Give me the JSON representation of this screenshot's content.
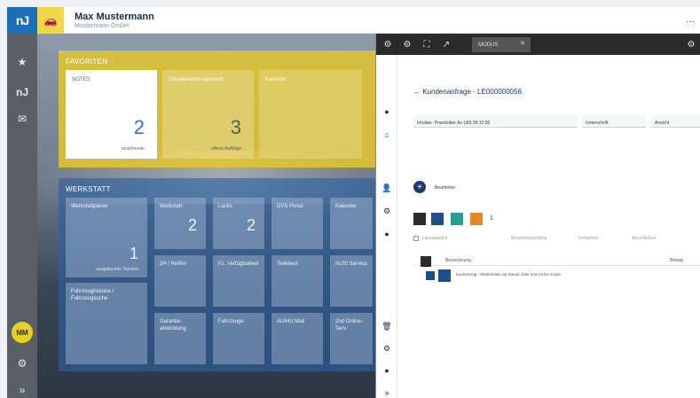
{
  "header": {
    "user_name": "Max Mustermann",
    "user_company": "Mustermann GmbH",
    "more": "...",
    "logo_text": "nJ"
  },
  "rail": {
    "avatar_initials": "MM",
    "collapse_glyph": "»"
  },
  "favoriten": {
    "title": "FAVORITEN",
    "tiles": [
      {
        "label": "NOTES",
        "value": "2",
        "sub": "anstehende"
      },
      {
        "label": "Schadensmanagement",
        "value": "3",
        "sub": "offene Aufträge"
      },
      {
        "label": "Kalender",
        "value": "",
        "sub": ""
      }
    ]
  },
  "werkstatt": {
    "title": "WERKSTATT",
    "tiles": [
      {
        "label": "Werkstattplaner",
        "value": "1",
        "sub": "ausgebuchte Termine"
      },
      {
        "label": "Fahrzeughistorie / Fahrzeugsuche",
        "value": "",
        "sub": ""
      },
      {
        "label": "Werkstatt",
        "value": "2",
        "sub": ""
      },
      {
        "label": "Lacks",
        "value": "2",
        "sub": ""
      },
      {
        "label": "DVS Portal",
        "value": "",
        "sub": ""
      },
      {
        "label": "Kalender",
        "value": "",
        "sub": ""
      },
      {
        "label": "2H / Reifen",
        "value": "",
        "sub": ""
      },
      {
        "label": "Fz. Verfügbarkeit",
        "value": "",
        "sub": ""
      },
      {
        "label": "Teilebest.",
        "value": "",
        "sub": ""
      },
      {
        "label": "AUSt Service",
        "value": "",
        "sub": ""
      },
      {
        "label": "Garantie- abwicklung",
        "value": "",
        "sub": ""
      },
      {
        "label": "Fahrzeuge",
        "value": "",
        "sub": ""
      },
      {
        "label": "AU/HU Mail",
        "value": "",
        "sub": ""
      },
      {
        "label": "2nd Online-Serv",
        "value": "",
        "sub": ""
      }
    ]
  },
  "panel": {
    "tab_label": "MODUS",
    "title": "Kundenanfrage - LE000000056",
    "field1_value": "Inhaber: Prandsitter Ae (d0) 09:10:00",
    "field2_value": "Unterschrift",
    "field3_value": "Ansicht",
    "field4_value": "",
    "row_add_label": "Bearbeiter",
    "toolbar_labels": [
      "Lausgewählt",
      "Bearbeitungsfähig",
      "Freigeben",
      "Abschließen"
    ],
    "table_header": [
      "Bezeichnung",
      "Betrag"
    ],
    "table_rows": [
      {
        "text": "Kaufvertrag - Weiterleiten an Steuer, bitte erst vorher Kopie"
      }
    ],
    "counter": "1"
  },
  "colors": {
    "brand_blue": "#1d6fb8",
    "accent_yellow": "#f1d64a",
    "panel_dark": "#2a2a2a",
    "navy": "#1c2f55"
  }
}
